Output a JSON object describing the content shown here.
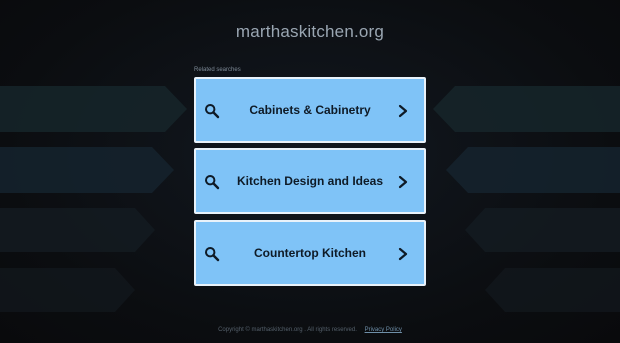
{
  "header": {
    "domain": "marthaskitchen.org"
  },
  "related": {
    "label": "Related searches",
    "items": [
      {
        "label": "Cabinets & Cabinetry"
      },
      {
        "label": "Kitchen Design and Ideas"
      },
      {
        "label": "Countertop Kitchen"
      }
    ]
  },
  "footer": {
    "copyright": "Copyright © marthaskitchen.org . All rights reserved.",
    "privacy_label": "Privacy Policy"
  },
  "colors": {
    "background": "#0d0f12",
    "button_bg": "#7fc3f7",
    "button_border": "#e9f2fa",
    "button_text": "#0e1a26",
    "title_text": "#9aa6b2"
  },
  "icons": [
    "search-icon",
    "chevron-right-icon"
  ]
}
